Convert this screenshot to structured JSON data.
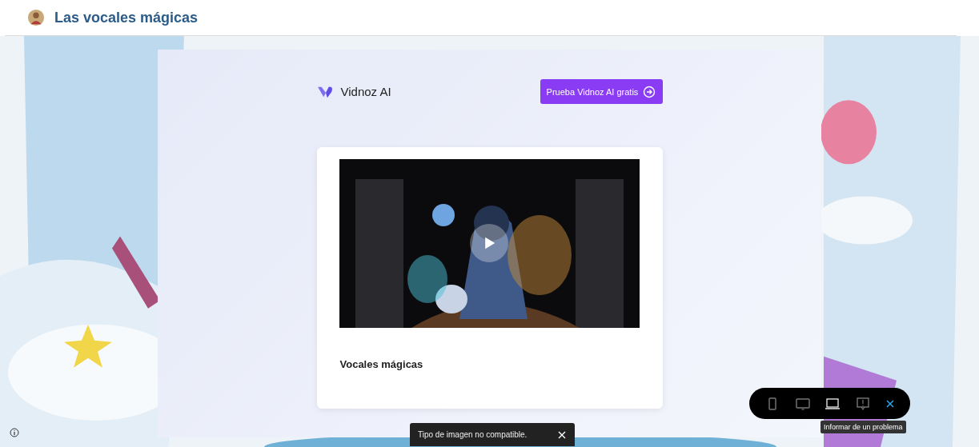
{
  "header": {
    "title": "Las vocales mágicas"
  },
  "brand": {
    "name": "Vidnoz AI"
  },
  "cta_button": {
    "label": "Prueba Vidnoz AI gratis"
  },
  "video": {
    "kind": "picture",
    "caption": "Vocales mágicas"
  },
  "device_toolbar": {
    "buttons": [
      {
        "kind": "phone",
        "selected": false
      },
      {
        "kind": "tablet",
        "selected": false
      },
      {
        "kind": "laptop",
        "selected": true
      },
      {
        "kind": "report",
        "selected": false
      }
    ],
    "tooltip": "Informar de un problema"
  },
  "toast": {
    "message": "Tipo de imagen no compatible."
  }
}
